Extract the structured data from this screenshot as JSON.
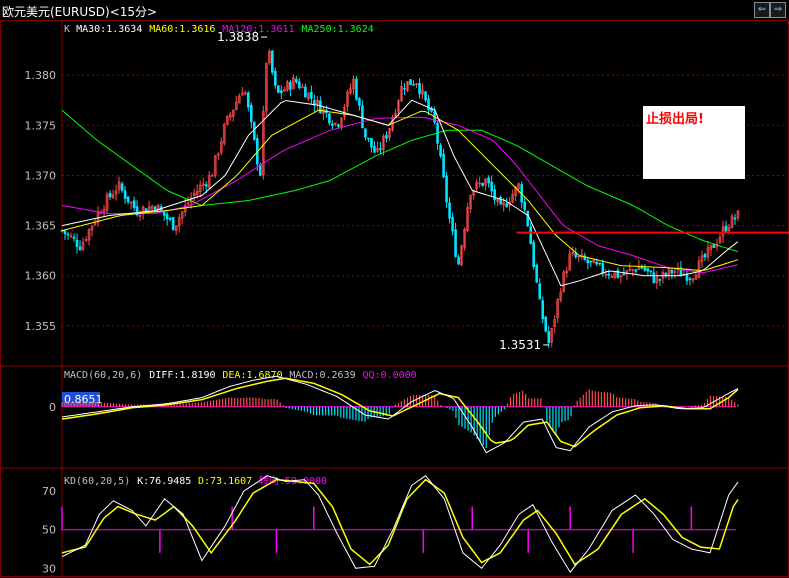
{
  "title": "欧元美元(EURUSD)<15分>",
  "nav": {
    "prev_icon": "left-arrow-icon",
    "next_icon": "right-arrow-icon"
  },
  "annotation": "止损出局!",
  "colors": {
    "bg": "#000000",
    "grid": "#8b0000",
    "up": "#ff4b4b",
    "down": "#00e5ff",
    "ma30": "#ffffff",
    "ma60": "#ffff00",
    "ma120": "#ff00ff",
    "ma250": "#00ff00",
    "level": "#ff0000",
    "diff": "#ffffff",
    "dea": "#ffff00",
    "kline": "#ffffff",
    "dline": "#ffff00",
    "turn": "#ff00ff"
  },
  "chart_data": [
    {
      "type": "candlestick",
      "legend": [
        {
          "label": "K",
          "color": "#c0c0c0"
        },
        {
          "label": "MA30:1.3634",
          "color": "#ffffff"
        },
        {
          "label": "MA60:1.3616",
          "color": "#ffff00"
        },
        {
          "label": "MA120:1.3611",
          "color": "#ff00ff"
        },
        {
          "label": "MA250:1.3624",
          "color": "#00ff00"
        }
      ],
      "yticks": [
        "1.380",
        "1.375",
        "1.370",
        "1.365",
        "1.360",
        "1.355"
      ],
      "ylim": [
        1.351,
        1.3855
      ],
      "high_label": "1.3838",
      "low_label": "1.3531",
      "stop_level": 1.3643,
      "bars": 226,
      "close_path": [
        [
          0,
          1.3645
        ],
        [
          8,
          1.363
        ],
        [
          16,
          1.3665
        ],
        [
          24,
          1.369
        ],
        [
          32,
          1.3665
        ],
        [
          40,
          1.367
        ],
        [
          48,
          1.365
        ],
        [
          56,
          1.368
        ],
        [
          64,
          1.37
        ],
        [
          70,
          1.375
        ],
        [
          78,
          1.379
        ],
        [
          85,
          1.37
        ],
        [
          88,
          1.383
        ],
        [
          92,
          1.378
        ],
        [
          100,
          1.3795
        ],
        [
          110,
          1.377
        ],
        [
          118,
          1.375
        ],
        [
          125,
          1.3795
        ],
        [
          130,
          1.374
        ],
        [
          135,
          1.372
        ],
        [
          140,
          1.3745
        ],
        [
          146,
          1.379
        ],
        [
          152,
          1.3795
        ],
        [
          160,
          1.375
        ],
        [
          166,
          1.366
        ],
        [
          170,
          1.361
        ],
        [
          175,
          1.3685
        ],
        [
          182,
          1.3695
        ],
        [
          188,
          1.3665
        ],
        [
          196,
          1.369
        ],
        [
          200,
          1.365
        ],
        [
          205,
          1.357
        ],
        [
          209,
          1.3531
        ],
        [
          214,
          1.359
        ],
        [
          218,
          1.362
        ],
        [
          224,
          1.3615
        ],
        [
          232,
          1.3605
        ],
        [
          240,
          1.36
        ],
        [
          248,
          1.361
        ],
        [
          255,
          1.3595
        ],
        [
          262,
          1.3605
        ],
        [
          270,
          1.36
        ],
        [
          278,
          1.3625
        ],
        [
          285,
          1.365
        ],
        [
          290,
          1.366
        ]
      ],
      "ma30_path": [
        [
          0,
          1.365
        ],
        [
          20,
          1.366
        ],
        [
          40,
          1.3665
        ],
        [
          60,
          1.368
        ],
        [
          70,
          1.37
        ],
        [
          80,
          1.374
        ],
        [
          95,
          1.3775
        ],
        [
          110,
          1.377
        ],
        [
          125,
          1.376
        ],
        [
          140,
          1.375
        ],
        [
          150,
          1.3775
        ],
        [
          160,
          1.3765
        ],
        [
          168,
          1.372
        ],
        [
          176,
          1.3685
        ],
        [
          190,
          1.3675
        ],
        [
          200,
          1.366
        ],
        [
          208,
          1.362
        ],
        [
          214,
          1.359
        ],
        [
          222,
          1.3595
        ],
        [
          235,
          1.3605
        ],
        [
          250,
          1.36
        ],
        [
          265,
          1.36
        ],
        [
          275,
          1.3605
        ],
        [
          285,
          1.3625
        ],
        [
          290,
          1.3634
        ]
      ],
      "ma60_path": [
        [
          0,
          1.3645
        ],
        [
          25,
          1.366
        ],
        [
          45,
          1.3665
        ],
        [
          60,
          1.367
        ],
        [
          75,
          1.37
        ],
        [
          90,
          1.374
        ],
        [
          110,
          1.3765
        ],
        [
          125,
          1.376
        ],
        [
          140,
          1.375
        ],
        [
          155,
          1.3765
        ],
        [
          170,
          1.3745
        ],
        [
          185,
          1.371
        ],
        [
          200,
          1.3675
        ],
        [
          212,
          1.364
        ],
        [
          222,
          1.362
        ],
        [
          240,
          1.361
        ],
        [
          260,
          1.3608
        ],
        [
          275,
          1.3605
        ],
        [
          290,
          1.3616
        ]
      ],
      "ma120_path": [
        [
          0,
          1.367
        ],
        [
          20,
          1.3662
        ],
        [
          40,
          1.3662
        ],
        [
          55,
          1.367
        ],
        [
          75,
          1.3695
        ],
        [
          95,
          1.3725
        ],
        [
          115,
          1.3745
        ],
        [
          135,
          1.3757
        ],
        [
          155,
          1.3758
        ],
        [
          170,
          1.375
        ],
        [
          185,
          1.3735
        ],
        [
          195,
          1.371
        ],
        [
          205,
          1.368
        ],
        [
          215,
          1.365
        ],
        [
          230,
          1.363
        ],
        [
          245,
          1.362
        ],
        [
          260,
          1.3608
        ],
        [
          275,
          1.3603
        ],
        [
          290,
          1.3611
        ]
      ],
      "ma250_path": [
        [
          0,
          1.3765
        ],
        [
          15,
          1.3735
        ],
        [
          30,
          1.371
        ],
        [
          45,
          1.3685
        ],
        [
          60,
          1.367
        ],
        [
          80,
          1.3675
        ],
        [
          100,
          1.3685
        ],
        [
          115,
          1.3695
        ],
        [
          135,
          1.372
        ],
        [
          150,
          1.3735
        ],
        [
          165,
          1.3745
        ],
        [
          180,
          1.3745
        ],
        [
          195,
          1.373
        ],
        [
          210,
          1.371
        ],
        [
          225,
          1.369
        ],
        [
          245,
          1.367
        ],
        [
          260,
          1.365
        ],
        [
          275,
          1.3635
        ],
        [
          290,
          1.3624
        ]
      ]
    },
    {
      "type": "line",
      "legend": [
        {
          "label": "MACD(60,20,6)",
          "color": "#c0c0c0"
        },
        {
          "label": "DIFF:1.8190",
          "color": "#ffffff"
        },
        {
          "label": "DEA:1.6870",
          "color": "#ffff00"
        },
        {
          "label": "MACD:0.2639",
          "color": "#c0c0c0"
        },
        {
          "label": "QQ:0.0000",
          "color": "#ff00ff"
        }
      ],
      "yticks": [
        "0"
      ],
      "marker_label": "0.8651",
      "ylim": [
        -6,
        4
      ],
      "diff_path": [
        [
          0,
          -1.0
        ],
        [
          15,
          -0.5
        ],
        [
          30,
          0.0
        ],
        [
          45,
          0.3
        ],
        [
          60,
          0.9
        ],
        [
          72,
          2.0
        ],
        [
          82,
          2.6
        ],
        [
          92,
          3.0
        ],
        [
          105,
          2.2
        ],
        [
          118,
          1.0
        ],
        [
          130,
          -0.8
        ],
        [
          140,
          -1.2
        ],
        [
          150,
          0.5
        ],
        [
          160,
          1.6
        ],
        [
          168,
          0.8
        ],
        [
          176,
          -2.0
        ],
        [
          182,
          -4.5
        ],
        [
          190,
          -3.5
        ],
        [
          198,
          -1.5
        ],
        [
          206,
          -1.2
        ],
        [
          212,
          -4.0
        ],
        [
          218,
          -4.3
        ],
        [
          226,
          -2.0
        ],
        [
          236,
          -0.5
        ],
        [
          246,
          0.1
        ],
        [
          255,
          0.2
        ],
        [
          265,
          -0.2
        ],
        [
          275,
          -0.1
        ],
        [
          285,
          1.2
        ],
        [
          290,
          1.8
        ]
      ],
      "dea_path": [
        [
          0,
          -1.2
        ],
        [
          15,
          -0.7
        ],
        [
          30,
          -0.1
        ],
        [
          45,
          0.2
        ],
        [
          60,
          0.7
        ],
        [
          75,
          1.8
        ],
        [
          88,
          2.5
        ],
        [
          96,
          2.8
        ],
        [
          108,
          2.3
        ],
        [
          120,
          1.2
        ],
        [
          132,
          -0.4
        ],
        [
          142,
          -0.9
        ],
        [
          152,
          0.2
        ],
        [
          162,
          1.3
        ],
        [
          170,
          0.9
        ],
        [
          178,
          -1.4
        ],
        [
          185,
          -3.6
        ],
        [
          193,
          -3.3
        ],
        [
          200,
          -1.8
        ],
        [
          208,
          -1.5
        ],
        [
          214,
          -3.4
        ],
        [
          220,
          -3.9
        ],
        [
          228,
          -2.4
        ],
        [
          238,
          -0.8
        ],
        [
          248,
          -0.1
        ],
        [
          258,
          0.1
        ],
        [
          268,
          -0.2
        ],
        [
          278,
          -0.2
        ],
        [
          286,
          0.9
        ],
        [
          290,
          1.7
        ]
      ]
    },
    {
      "type": "line",
      "legend": [
        {
          "label": "KD(60,20,5)",
          "color": "#c0c0c0"
        },
        {
          "label": "K:76.9485",
          "color": "#ffffff"
        },
        {
          "label": "D:73.1607",
          "color": "#ffff00"
        },
        {
          "label": "转向:50.0000",
          "color": "#ff00ff"
        }
      ],
      "yticks": [
        "70",
        "50",
        "30"
      ],
      "ylim": [
        26,
        82
      ],
      "k_path": [
        [
          0,
          36
        ],
        [
          10,
          42
        ],
        [
          16,
          58
        ],
        [
          22,
          65
        ],
        [
          30,
          60
        ],
        [
          36,
          52
        ],
        [
          44,
          66
        ],
        [
          52,
          58
        ],
        [
          60,
          34
        ],
        [
          70,
          52
        ],
        [
          78,
          70
        ],
        [
          88,
          78
        ],
        [
          96,
          75
        ],
        [
          104,
          76
        ],
        [
          110,
          68
        ],
        [
          118,
          48
        ],
        [
          126,
          30
        ],
        [
          134,
          31
        ],
        [
          142,
          50
        ],
        [
          150,
          73
        ],
        [
          156,
          78
        ],
        [
          164,
          66
        ],
        [
          172,
          38
        ],
        [
          180,
          30
        ],
        [
          188,
          42
        ],
        [
          196,
          58
        ],
        [
          202,
          63
        ],
        [
          210,
          44
        ],
        [
          218,
          28
        ],
        [
          226,
          40
        ],
        [
          236,
          60
        ],
        [
          246,
          68
        ],
        [
          254,
          58
        ],
        [
          262,
          45
        ],
        [
          270,
          40
        ],
        [
          278,
          38
        ],
        [
          286,
          68
        ],
        [
          292,
          78
        ]
      ],
      "d_path": [
        [
          0,
          38
        ],
        [
          10,
          41
        ],
        [
          18,
          56
        ],
        [
          24,
          62
        ],
        [
          32,
          58
        ],
        [
          40,
          55
        ],
        [
          48,
          62
        ],
        [
          56,
          52
        ],
        [
          64,
          38
        ],
        [
          74,
          54
        ],
        [
          82,
          69
        ],
        [
          92,
          76
        ],
        [
          100,
          75
        ],
        [
          108,
          74
        ],
        [
          116,
          62
        ],
        [
          124,
          40
        ],
        [
          132,
          32
        ],
        [
          140,
          42
        ],
        [
          148,
          66
        ],
        [
          156,
          76
        ],
        [
          164,
          69
        ],
        [
          172,
          46
        ],
        [
          180,
          33
        ],
        [
          188,
          38
        ],
        [
          198,
          55
        ],
        [
          204,
          60
        ],
        [
          212,
          48
        ],
        [
          220,
          32
        ],
        [
          230,
          40
        ],
        [
          240,
          58
        ],
        [
          250,
          66
        ],
        [
          258,
          58
        ],
        [
          266,
          46
        ],
        [
          274,
          41
        ],
        [
          282,
          40
        ],
        [
          288,
          62
        ],
        [
          294,
          73
        ]
      ]
    }
  ]
}
